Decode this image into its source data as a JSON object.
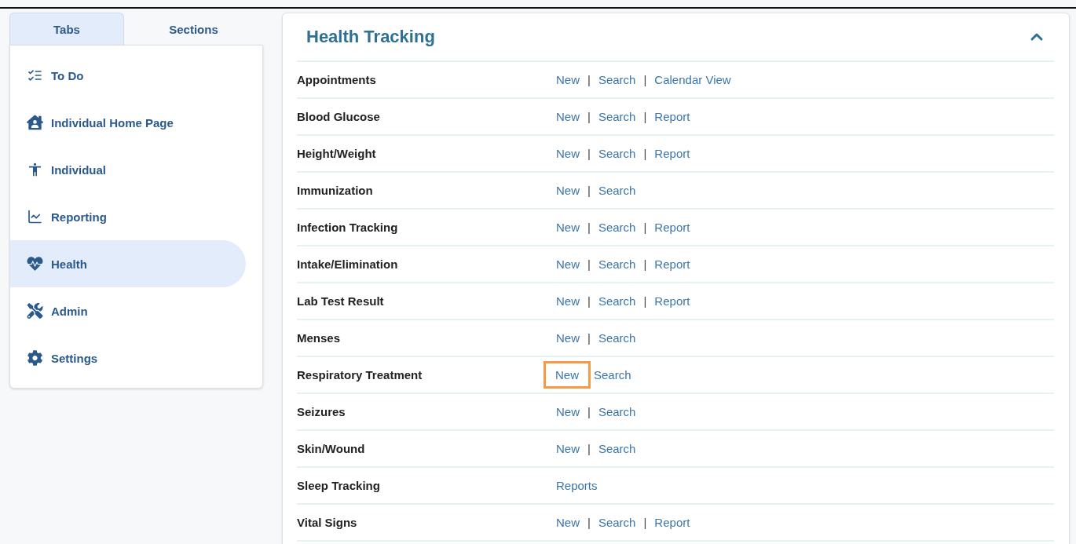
{
  "tabs": [
    {
      "label": "Tabs",
      "selected": true
    },
    {
      "label": "Sections",
      "selected": false
    }
  ],
  "nav": [
    {
      "label": "To Do",
      "selected": false
    },
    {
      "label": "Individual Home Page",
      "selected": false
    },
    {
      "label": "Individual",
      "selected": false
    },
    {
      "label": "Reporting",
      "selected": false
    },
    {
      "label": "Health",
      "selected": true
    },
    {
      "label": "Admin",
      "selected": false
    },
    {
      "label": "Settings",
      "selected": false
    }
  ],
  "panel": {
    "title": "Health Tracking",
    "expanded": true,
    "rows": [
      {
        "name": "Appointments",
        "actions": [
          {
            "kind": "link",
            "label": "New",
            "highlighted": false
          },
          {
            "kind": "separator",
            "label": "|"
          },
          {
            "kind": "link",
            "label": "Search",
            "highlighted": false
          },
          {
            "kind": "separator",
            "label": "|"
          },
          {
            "kind": "link",
            "label": "Calendar View",
            "highlighted": false
          }
        ]
      },
      {
        "name": "Blood Glucose",
        "actions": [
          {
            "kind": "link",
            "label": "New",
            "highlighted": false
          },
          {
            "kind": "separator",
            "label": "|"
          },
          {
            "kind": "link",
            "label": "Search",
            "highlighted": false
          },
          {
            "kind": "separator",
            "label": "|"
          },
          {
            "kind": "link",
            "label": "Report",
            "highlighted": false
          }
        ]
      },
      {
        "name": "Height/Weight",
        "actions": [
          {
            "kind": "link",
            "label": "New",
            "highlighted": false
          },
          {
            "kind": "separator",
            "label": "|"
          },
          {
            "kind": "link",
            "label": "Search",
            "highlighted": false
          },
          {
            "kind": "separator",
            "label": "|"
          },
          {
            "kind": "link",
            "label": "Report",
            "highlighted": false
          }
        ]
      },
      {
        "name": "Immunization",
        "actions": [
          {
            "kind": "link",
            "label": "New",
            "highlighted": false
          },
          {
            "kind": "separator",
            "label": "|"
          },
          {
            "kind": "link",
            "label": "Search",
            "highlighted": false
          }
        ]
      },
      {
        "name": "Infection Tracking",
        "actions": [
          {
            "kind": "link",
            "label": "New",
            "highlighted": false
          },
          {
            "kind": "separator",
            "label": "|"
          },
          {
            "kind": "link",
            "label": "Search",
            "highlighted": false
          },
          {
            "kind": "separator",
            "label": "|"
          },
          {
            "kind": "link",
            "label": "Report",
            "highlighted": false
          }
        ]
      },
      {
        "name": "Intake/Elimination",
        "actions": [
          {
            "kind": "link",
            "label": "New",
            "highlighted": false
          },
          {
            "kind": "separator",
            "label": "|"
          },
          {
            "kind": "link",
            "label": "Search",
            "highlighted": false
          },
          {
            "kind": "separator",
            "label": "|"
          },
          {
            "kind": "link",
            "label": "Report",
            "highlighted": false
          }
        ]
      },
      {
        "name": "Lab Test Result",
        "actions": [
          {
            "kind": "link",
            "label": "New",
            "highlighted": false
          },
          {
            "kind": "separator",
            "label": "|"
          },
          {
            "kind": "link",
            "label": "Search",
            "highlighted": false
          },
          {
            "kind": "separator",
            "label": "|"
          },
          {
            "kind": "link",
            "label": "Report",
            "highlighted": false
          }
        ]
      },
      {
        "name": "Menses",
        "actions": [
          {
            "kind": "link",
            "label": "New",
            "highlighted": false
          },
          {
            "kind": "separator",
            "label": "|"
          },
          {
            "kind": "link",
            "label": "Search",
            "highlighted": false
          }
        ]
      },
      {
        "name": "Respiratory Treatment",
        "actions": [
          {
            "kind": "link",
            "label": "New",
            "highlighted": true
          },
          {
            "kind": "link",
            "label": "Search",
            "highlighted": false
          }
        ]
      },
      {
        "name": "Seizures",
        "actions": [
          {
            "kind": "link",
            "label": "New",
            "highlighted": false
          },
          {
            "kind": "separator",
            "label": "|"
          },
          {
            "kind": "link",
            "label": "Search",
            "highlighted": false
          }
        ]
      },
      {
        "name": "Skin/Wound",
        "actions": [
          {
            "kind": "link",
            "label": "New",
            "highlighted": false
          },
          {
            "kind": "separator",
            "label": "|"
          },
          {
            "kind": "link",
            "label": "Search",
            "highlighted": false
          }
        ]
      },
      {
        "name": "Sleep Tracking",
        "actions": [
          {
            "kind": "link",
            "label": "Reports",
            "highlighted": false
          }
        ]
      },
      {
        "name": "Vital Signs",
        "actions": [
          {
            "kind": "link",
            "label": "New",
            "highlighted": false
          },
          {
            "kind": "separator",
            "label": "|"
          },
          {
            "kind": "link",
            "label": "Search",
            "highlighted": false
          },
          {
            "kind": "separator",
            "label": "|"
          },
          {
            "kind": "link",
            "label": "Report",
            "highlighted": false
          }
        ]
      }
    ]
  }
}
